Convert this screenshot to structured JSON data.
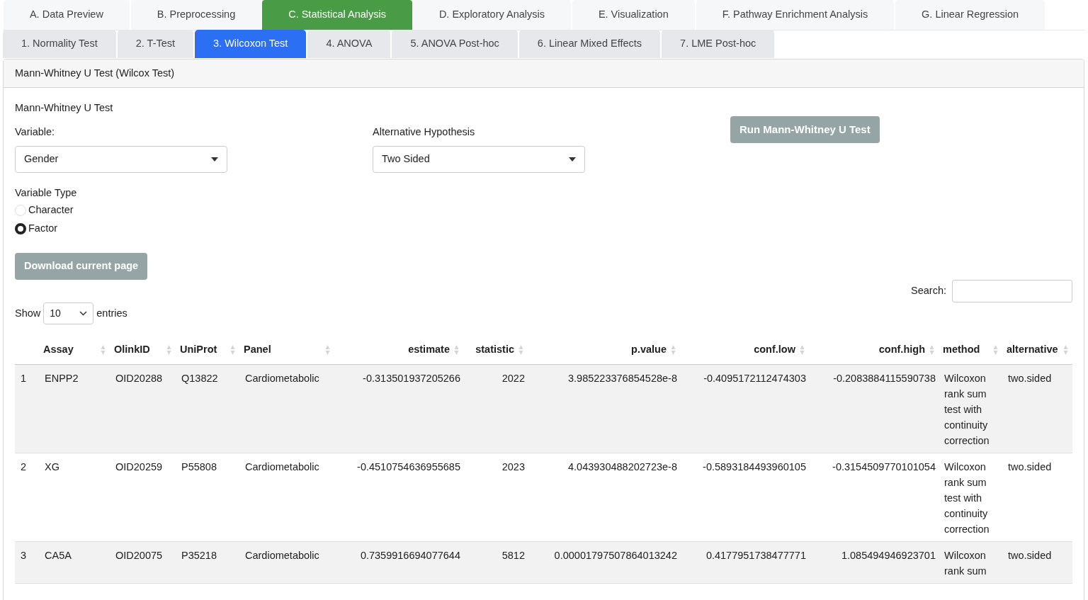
{
  "main_tabs": [
    {
      "label": "A. Data Preview",
      "selected": false
    },
    {
      "label": "B. Preprocessing",
      "selected": false
    },
    {
      "label": "C. Statistical Analysis",
      "selected": true
    },
    {
      "label": "D. Exploratory Analysis",
      "selected": false
    },
    {
      "label": "E. Visualization",
      "selected": false
    },
    {
      "label": "F. Pathway Enrichment Analysis",
      "selected": false
    },
    {
      "label": "G. Linear Regression",
      "selected": false
    }
  ],
  "sub_tabs": [
    {
      "label": "1. Normality Test",
      "selected": false
    },
    {
      "label": "2. T-Test",
      "selected": false
    },
    {
      "label": "3. Wilcoxon Test",
      "selected": true
    },
    {
      "label": "4. ANOVA",
      "selected": false
    },
    {
      "label": "5. ANOVA Post-hoc",
      "selected": false
    },
    {
      "label": "6. Linear Mixed Effects",
      "selected": false
    },
    {
      "label": "7. LME Post-hoc",
      "selected": false
    }
  ],
  "panel_title": "Mann-Whitney U Test (Wilcox Test)",
  "section_title": "Mann-Whitney U Test",
  "variable": {
    "label": "Variable:",
    "value": "Gender"
  },
  "alternative": {
    "label": "Alternative Hypothesis",
    "value": "Two Sided"
  },
  "run_button": "Run Mann-Whitney U Test",
  "variable_type": {
    "label": "Variable Type",
    "options": [
      {
        "label": "Character",
        "selected": false
      },
      {
        "label": "Factor",
        "selected": true
      }
    ]
  },
  "download_button": "Download current page",
  "search_label": "Search:",
  "show": {
    "before": "Show",
    "value": "10",
    "after": "entries"
  },
  "table": {
    "columns": [
      "",
      "Assay",
      "OlinkID",
      "UniProt",
      "Panel",
      "estimate",
      "statistic",
      "p.value",
      "conf.low",
      "conf.high",
      "method",
      "alternative"
    ],
    "rows": [
      [
        "1",
        "ENPP2",
        "OID20288",
        "Q13822",
        "Cardiometabolic",
        "-0.313501937205266",
        "2022",
        "3.985223376854528e-8",
        "-0.4095172112474303",
        "-0.2083884115590738",
        "Wilcoxon rank sum test with continuity correction",
        "two.sided"
      ],
      [
        "2",
        "XG",
        "OID20259",
        "P55808",
        "Cardiometabolic",
        "-0.4510754636955685",
        "2023",
        "4.043930488202723e-8",
        "-0.5893184493960105",
        "-0.3154509770101054",
        "Wilcoxon rank sum test with continuity correction",
        "two.sided"
      ],
      [
        "3",
        "CA5A",
        "OID20075",
        "P35218",
        "Cardiometabolic",
        "0.7359916694077644",
        "5812",
        "0.00001797507864013242",
        "0.4177951738477771",
        "1.085494946923701",
        "Wilcoxon rank sum",
        "two.sided"
      ]
    ]
  }
}
